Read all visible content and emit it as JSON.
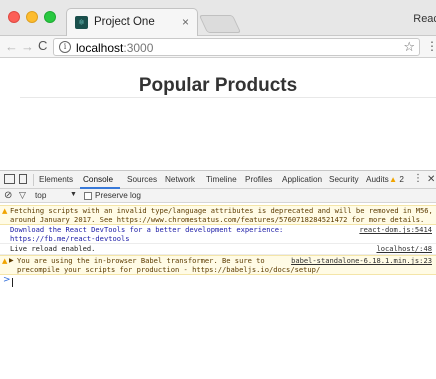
{
  "browser": {
    "tab_title": "Project One",
    "tab_close": "×",
    "profile_name": "React",
    "nav_back": "←",
    "nav_forward": "→",
    "nav_reload": "C",
    "url_host": "localhost",
    "url_port": ":3000",
    "star": "☆",
    "menu": "⋮"
  },
  "page": {
    "heading": "Popular Products"
  },
  "devtools": {
    "tabs": [
      "Elements",
      "Console",
      "Sources",
      "Network",
      "Timeline",
      "Profiles",
      "Application",
      "Security",
      "Audits"
    ],
    "active_tab": "Console",
    "warning_count": "2",
    "more": "⋮",
    "close": "✕",
    "context": "top",
    "context_caret": "▼",
    "preserve_log_label": "Preserve log",
    "accent_color": "#3879d9",
    "messages": [
      {
        "level": "warning",
        "lines": [
          "Fetching scripts with an invalid type/language attributes is deprecated and will be removed in M56,",
          "around January 2017. See https://www.chromestatus.com/features/5760718284521472 for more details."
        ],
        "source": ""
      },
      {
        "level": "info",
        "lines": [
          "Download the React DevTools for a better development experience:",
          "https://fb.me/react-devtools"
        ],
        "source": "react-dom.js:5414"
      },
      {
        "level": "log",
        "lines": [
          "Live reload enabled."
        ],
        "source": "localhost/:48"
      },
      {
        "level": "warning",
        "lines": [
          "You are using the in-browser Babel transformer. Be sure to",
          "precompile your scripts for production - https://babeljs.io/docs/setup/"
        ],
        "source": "babel-standalone-6.18.1.min.js:23"
      }
    ],
    "prompt": ">"
  }
}
